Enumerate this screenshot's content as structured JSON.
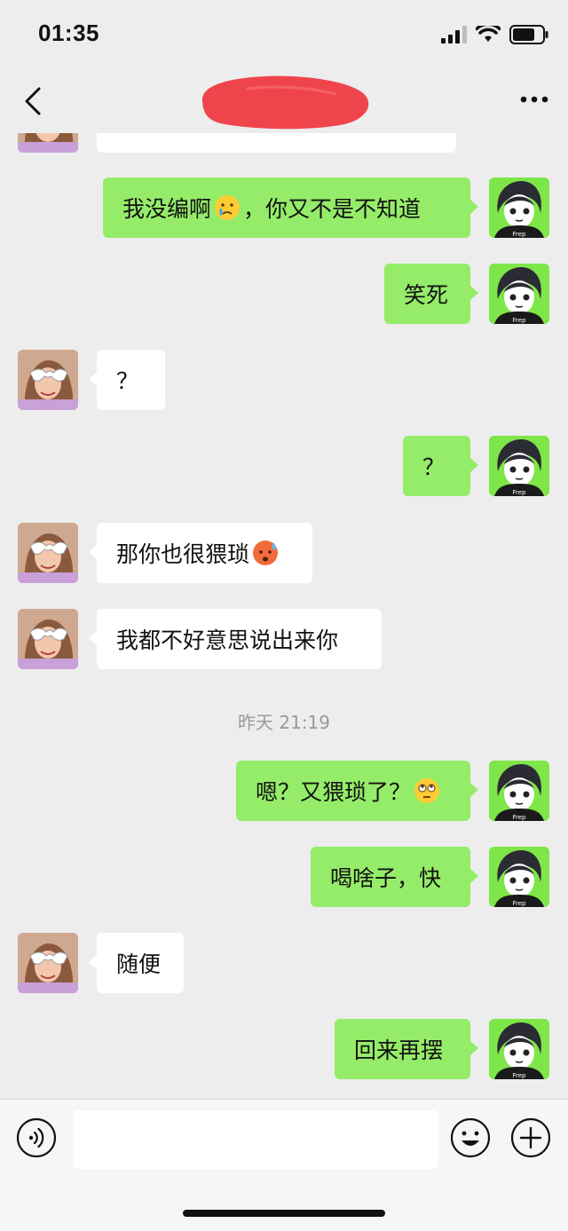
{
  "status_bar": {
    "time": "01:35"
  },
  "nav": {
    "title": ""
  },
  "messages": [
    {
      "sender": "other",
      "text": ""
    },
    {
      "sender": "me",
      "parts": [
        "我没编啊",
        "[emoji:crying-face]",
        "，你又不是不知道"
      ]
    },
    {
      "sender": "me",
      "text": "笑死"
    },
    {
      "sender": "other",
      "text": "？"
    },
    {
      "sender": "me",
      "text": "？"
    },
    {
      "sender": "other",
      "parts": [
        "那你也很猥琐",
        "[emoji:sweat-face]"
      ]
    },
    {
      "sender": "other",
      "text": "我都不好意思说出来你"
    },
    {
      "timestamp": "昨天 21:19"
    },
    {
      "sender": "me",
      "parts": [
        "嗯？又猥琐了？",
        "[emoji:eye-roll-face]"
      ]
    },
    {
      "sender": "me",
      "text": "喝啥子，快"
    },
    {
      "sender": "other",
      "text": "随便"
    },
    {
      "sender": "me",
      "text": "回来再摆"
    }
  ],
  "texts": {
    "m1a": "我没编啊",
    "m1b": "，你又不是不知道",
    "m2": "笑死",
    "m3": "？",
    "m4": "？",
    "m5": "那你也很猥琐",
    "m6": "我都不好意思说出来你",
    "ts": "昨天 21:19",
    "m7": "嗯？又猥琐了？",
    "m8": "喝啥子，快",
    "m9": "随便",
    "m10": "回来再摆"
  },
  "icons": {
    "back": "chevron-left-icon",
    "more": "more-dots-icon",
    "voice": "voice-icon",
    "emoji": "emoji-icon",
    "plus": "plus-icon"
  },
  "colors": {
    "background": "#ededed",
    "my_bubble": "#95ec69",
    "other_bubble": "#ffffff",
    "timestamp": "#9a9a9a",
    "redaction": "#f0444c"
  }
}
